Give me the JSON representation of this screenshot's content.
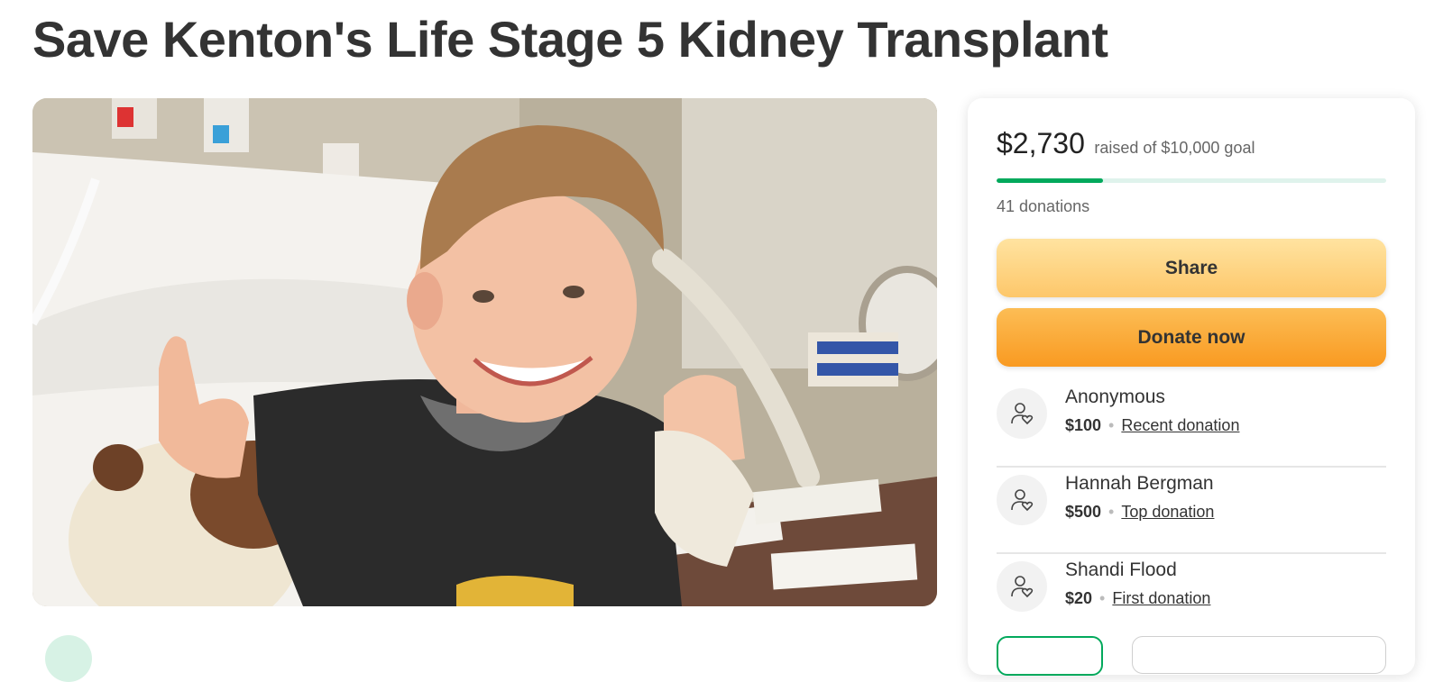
{
  "page": {
    "title": "Save Kenton's Life Stage 5 Kidney Transplant"
  },
  "hero": {
    "description": "photo"
  },
  "donation_card": {
    "raised_amount": "$2,730",
    "raised_text": "raised of $10,000 goal",
    "progress_fraction": 0.273,
    "donations_count": "41 donations",
    "share_label": "Share",
    "donate_label": "Donate now",
    "colors": {
      "progress": "#02a95c",
      "progress_track": "#dff3ec",
      "share_bg": "#fdd282",
      "donate_bg": "#f9a733"
    },
    "donors": [
      {
        "name": "Anonymous",
        "amount": "$100",
        "label": "Recent donation",
        "icon": "donor-heart-icon"
      },
      {
        "name": "Hannah Bergman",
        "amount": "$500",
        "label": "Top donation",
        "icon": "donor-heart-icon"
      },
      {
        "name": "Shandi Flood",
        "amount": "$20",
        "label": "First donation",
        "icon": "donor-heart-icon"
      }
    ]
  }
}
